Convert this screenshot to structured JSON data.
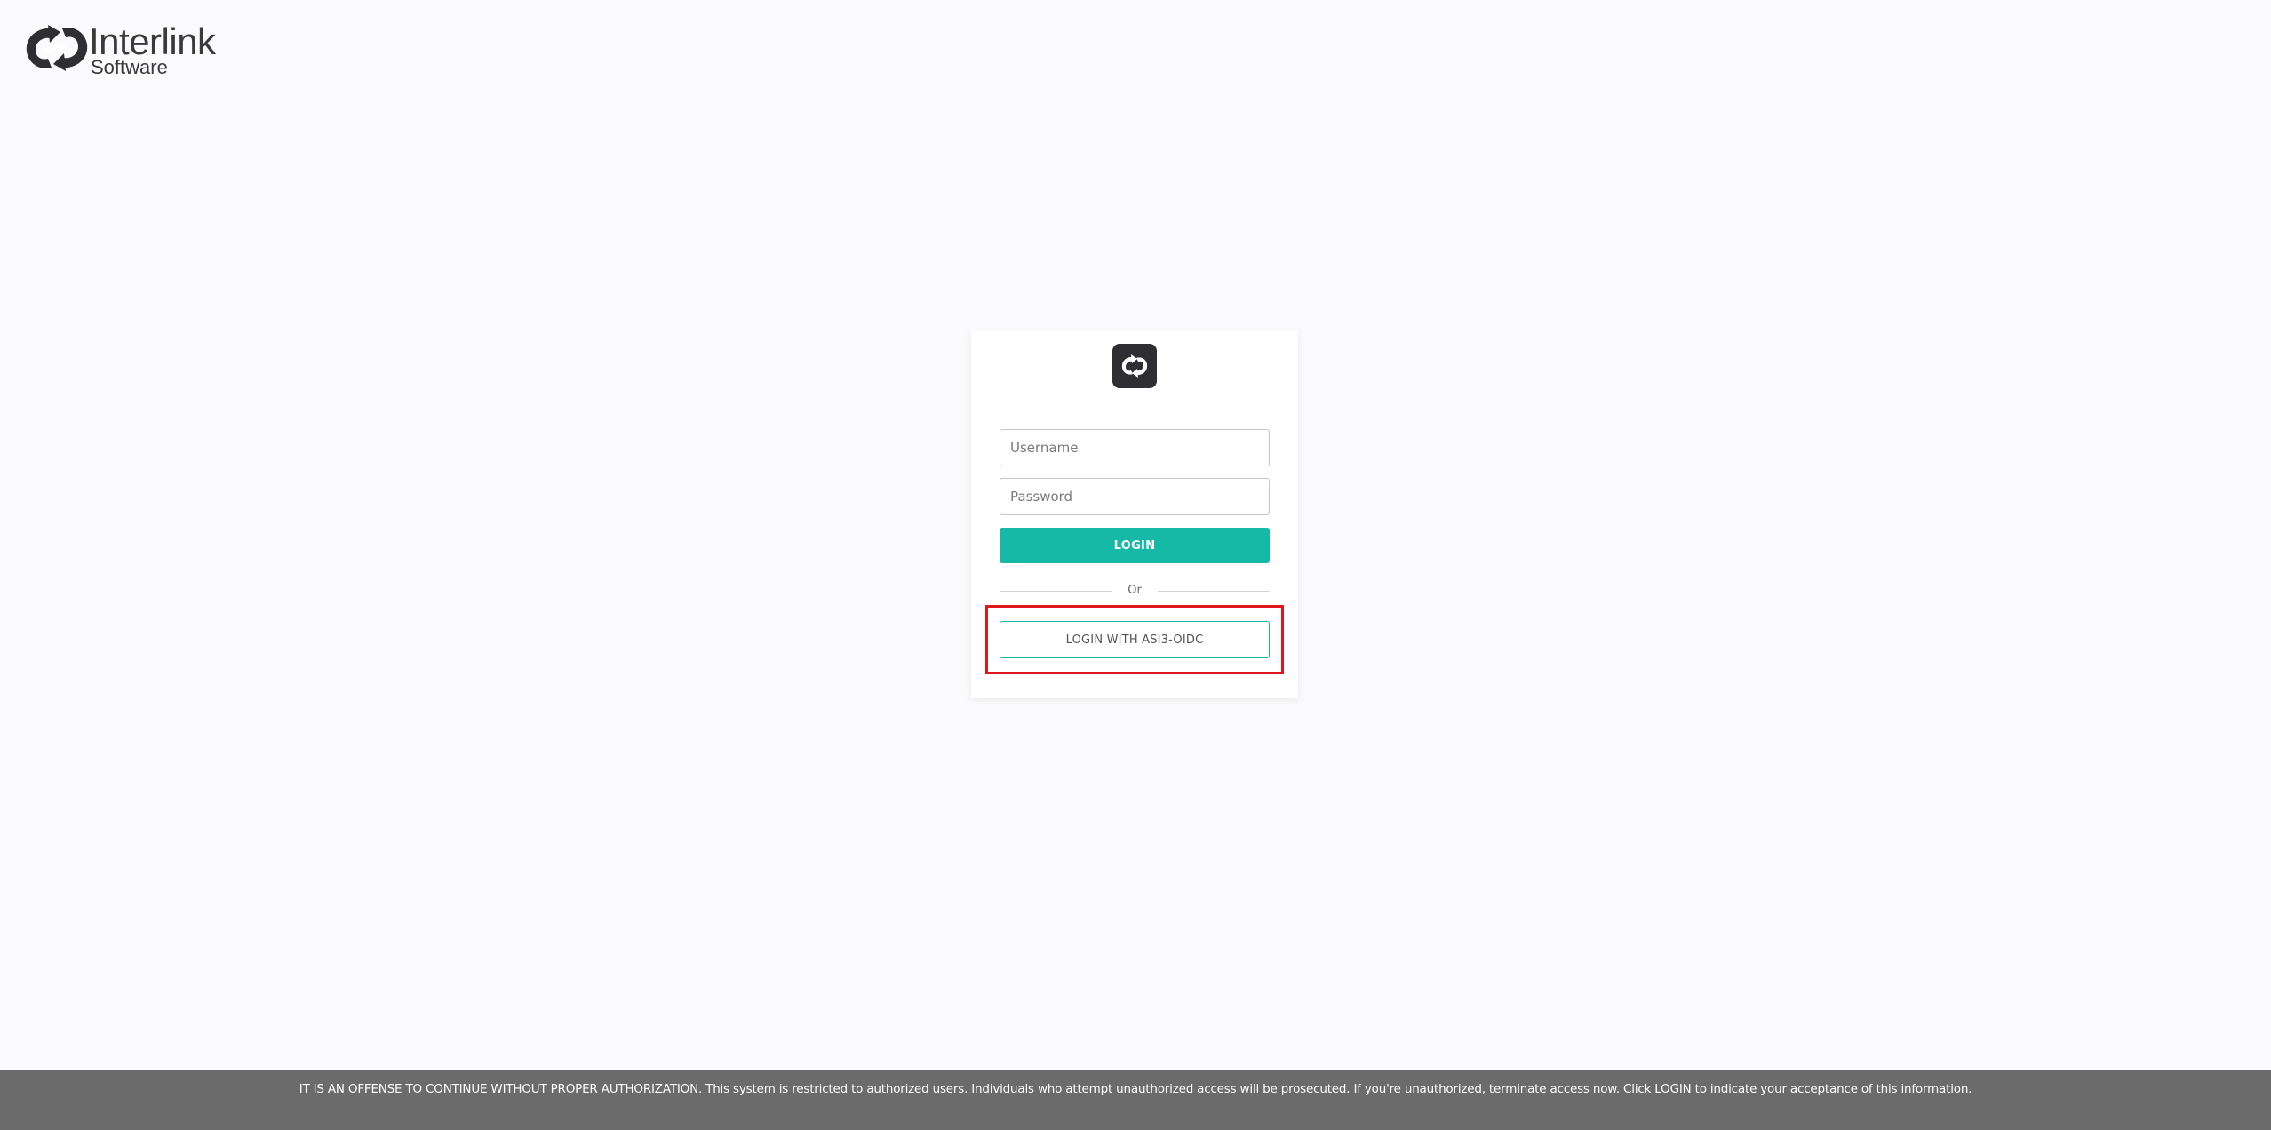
{
  "brand": {
    "name": "Interlink",
    "subtitle": "Software",
    "logo_icon": "interlink-chain-logo-icon"
  },
  "login_card": {
    "logo_icon": "interlink-chain-logo-icon",
    "username": {
      "placeholder": "Username",
      "value": ""
    },
    "password": {
      "placeholder": "Password",
      "value": ""
    },
    "login_label": "LOGIN",
    "divider_text": "Or",
    "oidc_label": "LOGIN WITH ASI3-OIDC"
  },
  "footer": {
    "notice": "IT IS AN OFFENSE TO CONTINUE WITHOUT PROPER AUTHORIZATION. This system is restricted to authorized users. Individuals who attempt unauthorized access will be prosecuted. If you're unauthorized, terminate access now. Click LOGIN to indicate your acceptance of this information."
  },
  "colors": {
    "accent": "#16b8a6",
    "highlight": "#e0161e",
    "footer_bg": "#6b6b6b",
    "page_bg": "#fbfbfd",
    "logo_dark": "#2f2f33"
  }
}
